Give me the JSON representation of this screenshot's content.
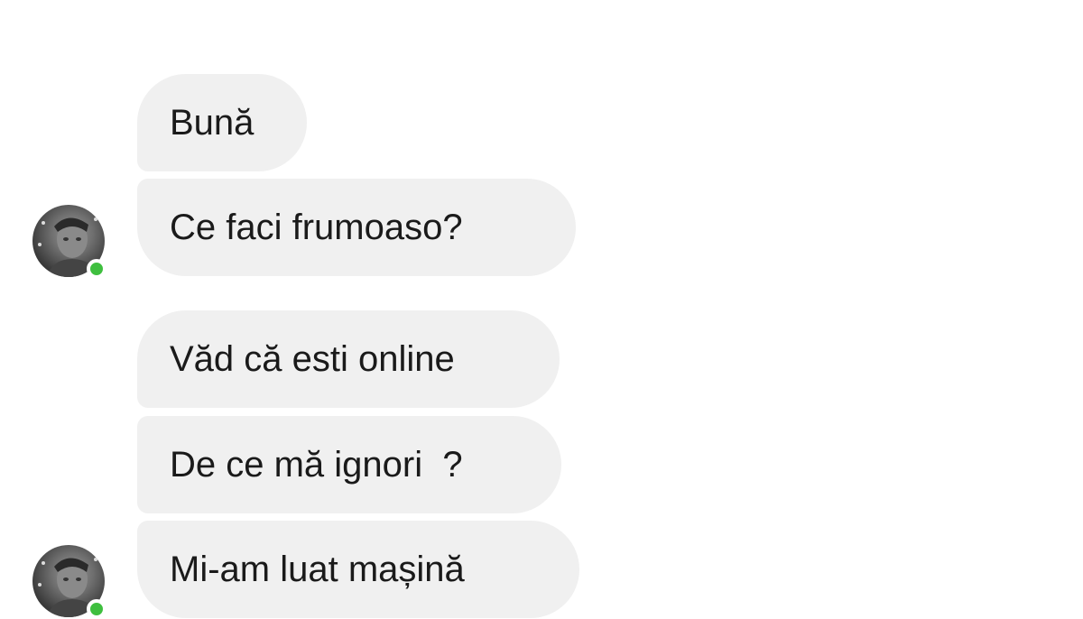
{
  "conversation": {
    "messages": [
      {
        "text": "Bună"
      },
      {
        "text": "Ce faci frumoaso?"
      },
      {
        "text": "Văd că esti online"
      },
      {
        "text": "De ce mă ignori  ?"
      },
      {
        "text": "Mi-am luat mașină"
      }
    ],
    "sender": {
      "online": true,
      "status_color": "#3fbf3f"
    }
  },
  "colors": {
    "bubble_background": "#f0f0f0",
    "text": "#1a1a1a",
    "page_background": "#ffffff"
  }
}
